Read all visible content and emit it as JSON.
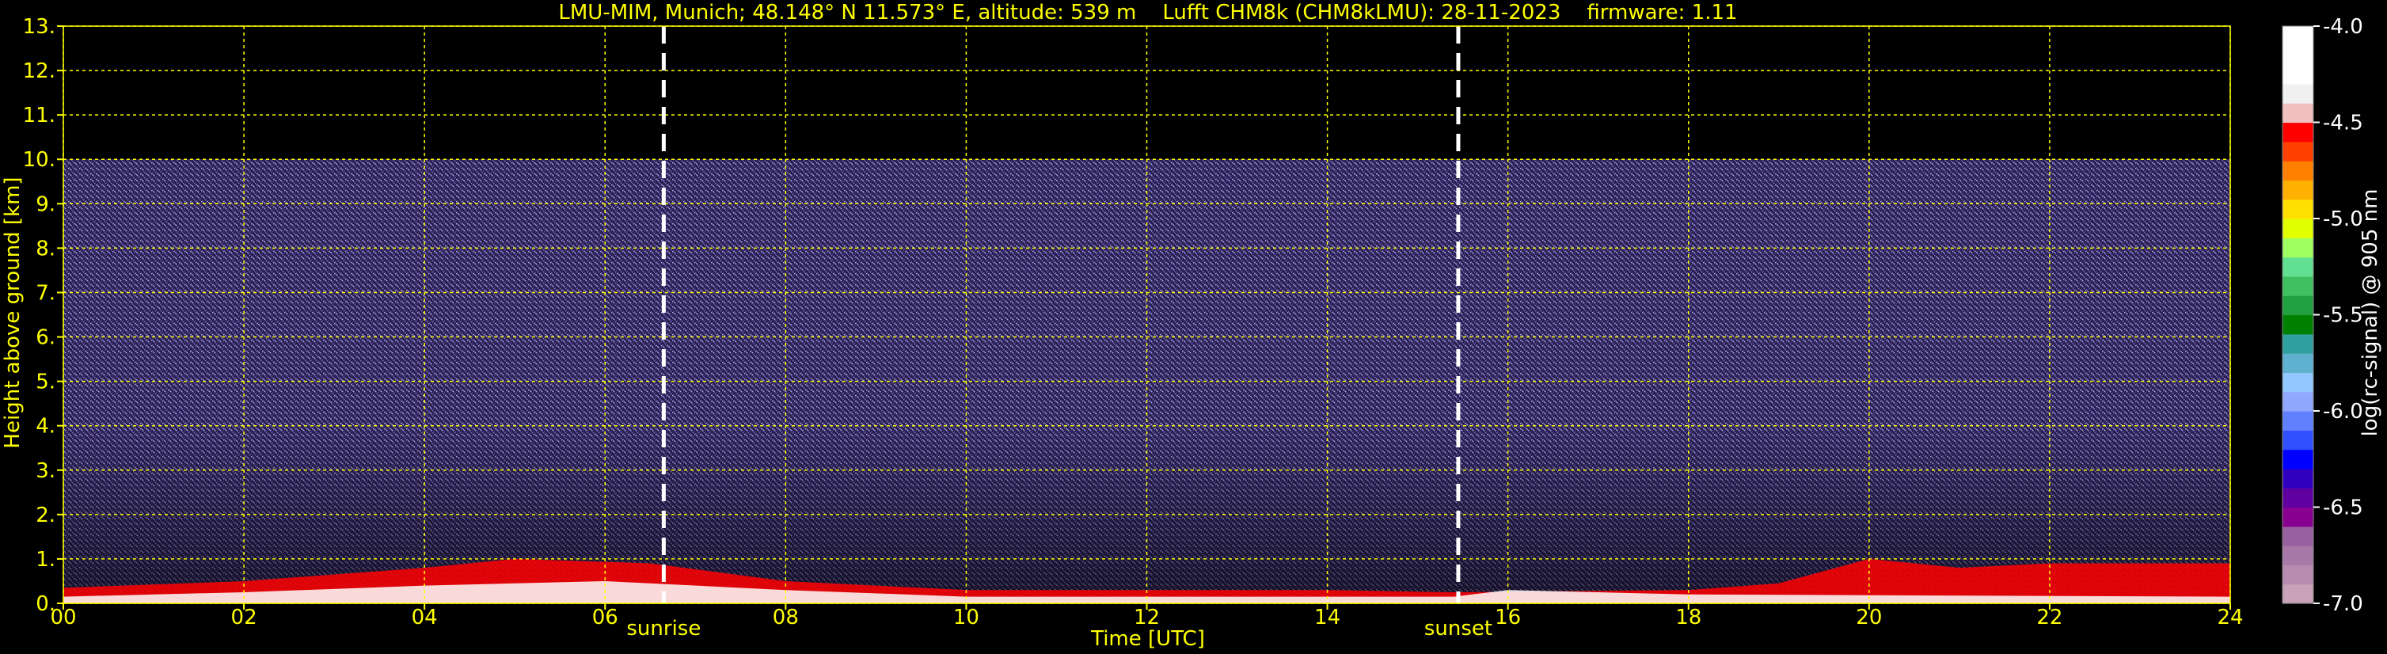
{
  "chart_data": {
    "type": "heatmap",
    "title": "LMU-MIM, Munich; 48.148° N 11.573° E, altitude: 539 m    Lufft CHM8k (CHM8kLMU): 28-11-2023    firmware: 1.11",
    "xlabel": "Time [UTC]",
    "ylabel": "Height above ground [km]",
    "xlim": [
      0,
      24
    ],
    "ylim": [
      0,
      13
    ],
    "x_ticks": [
      "00",
      "02",
      "04",
      "06",
      "08",
      "10",
      "12",
      "14",
      "16",
      "18",
      "20",
      "22",
      "24"
    ],
    "y_ticks": [
      "0.",
      "1.",
      "2.",
      "3.",
      "4.",
      "5.",
      "6.",
      "7.",
      "8.",
      "9.",
      "10.",
      "11.",
      "12.",
      "13."
    ],
    "grid": true,
    "grid_color": "#ffff00",
    "events": [
      {
        "label": "sunrise",
        "time": 6.65
      },
      {
        "label": "sunset",
        "time": 15.45
      }
    ],
    "signal_top_km": 10,
    "colorbar": {
      "label": "log(rc-signal) @ 905 nm",
      "range": [
        -7.0,
        -4.0
      ],
      "ticks": [
        "-4.0",
        "-4.5",
        "-5.0",
        "-5.5",
        "-6.0",
        "-6.5",
        "-7.0"
      ],
      "colors": [
        "#c8a2b8",
        "#b88cb0",
        "#a878a8",
        "#98609e",
        "#880090",
        "#6000a0",
        "#3000c0",
        "#0000ff",
        "#3050ff",
        "#6080ff",
        "#90a8ff",
        "#90c8ff",
        "#60b0d0",
        "#30a0a0",
        "#008000",
        "#20a040",
        "#40c060",
        "#60e090",
        "#a0ff60",
        "#e0ff00",
        "#ffe000",
        "#ffb000",
        "#ff8000",
        "#ff4000",
        "#ff0000",
        "#f0c0c0",
        "#f0f0f0",
        "#ffffff",
        "#ffffff",
        "#ffffff"
      ]
    }
  }
}
